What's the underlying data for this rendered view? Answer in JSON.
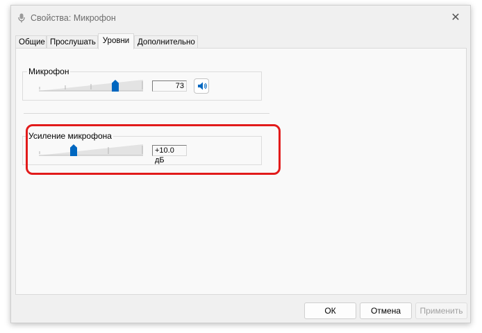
{
  "window": {
    "title": "Свойства: Микрофон",
    "close_glyph": "✕"
  },
  "tabs": [
    {
      "label": "Общие",
      "active": false
    },
    {
      "label": "Прослушать",
      "active": false
    },
    {
      "label": "Уровни",
      "active": true
    },
    {
      "label": "Дополнительно",
      "active": false
    }
  ],
  "levels": {
    "microphone": {
      "label": "Микрофон",
      "value": "73",
      "slider_level": 0.73,
      "speaker_icon": "speaker-icon"
    },
    "boost": {
      "label": "Усиление микрофона",
      "value": "+10.0 дБ",
      "slider_level": 0.33
    }
  },
  "footer": {
    "ok": "ОК",
    "cancel": "Отмена",
    "apply": "Применить"
  },
  "colors": {
    "accent": "#0067c0",
    "highlight": "#e21b1b"
  }
}
